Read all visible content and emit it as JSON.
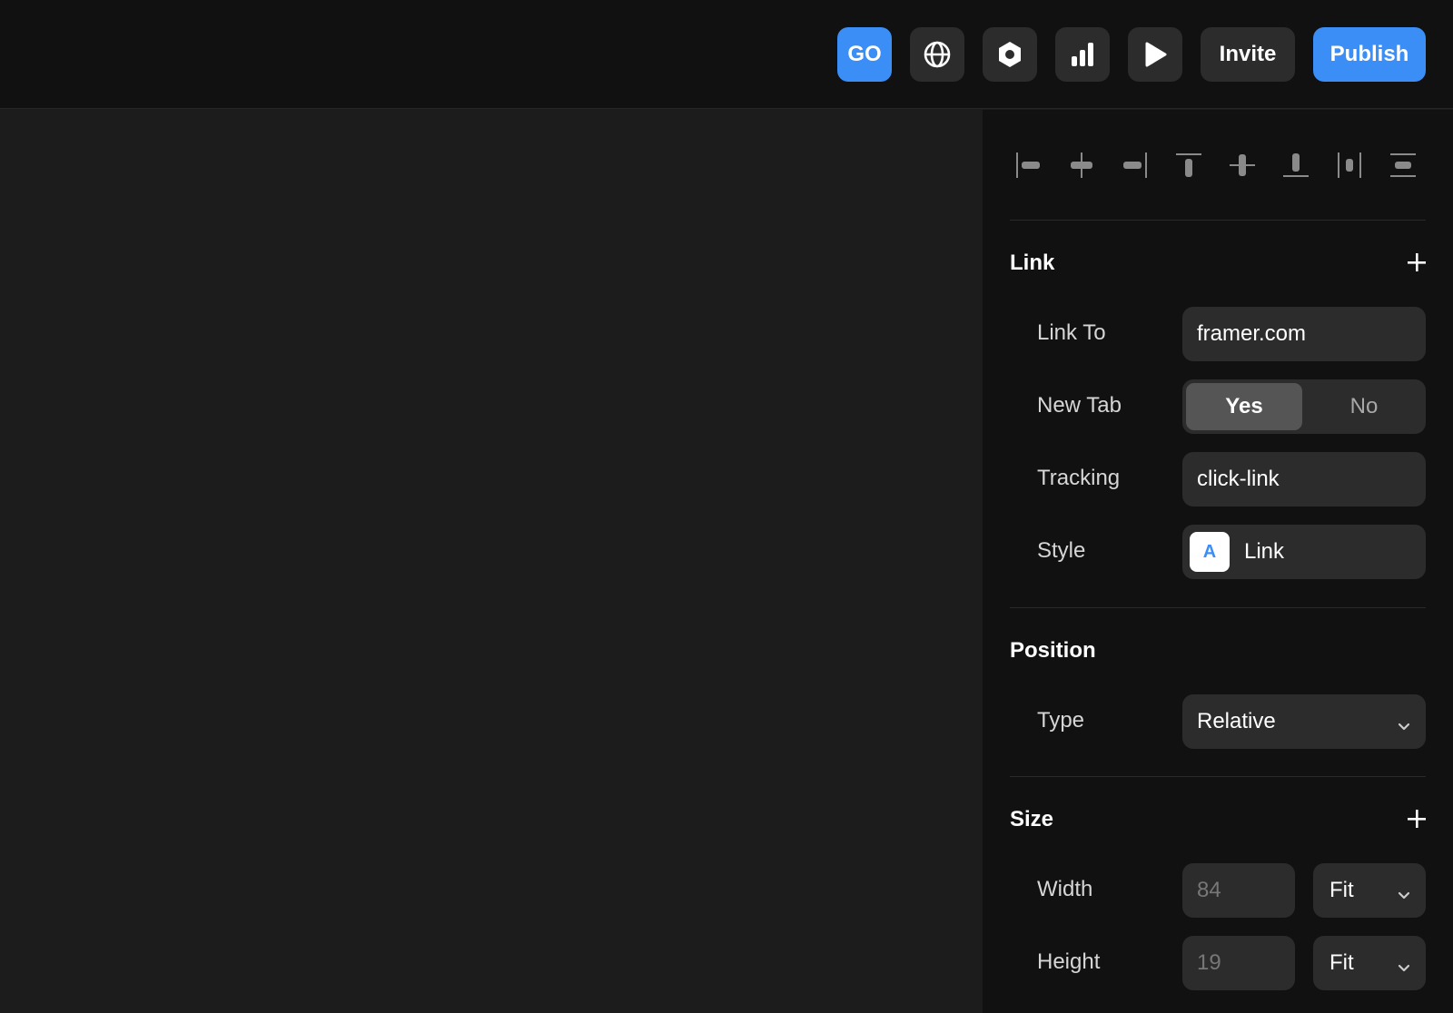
{
  "topbar": {
    "go_label": "GO",
    "invite_label": "Invite",
    "publish_label": "Publish",
    "icons": [
      "globe-icon",
      "hexagon-icon",
      "bar-chart-icon",
      "play-icon"
    ],
    "accent": "#3b8ef5"
  },
  "panel": {
    "align_icons": [
      "align-left-icon",
      "align-center-h-icon",
      "align-right-icon",
      "align-top-icon",
      "align-center-v-icon",
      "align-bottom-icon",
      "distribute-horizontal-icon",
      "distribute-vertical-icon"
    ],
    "link": {
      "title": "Link",
      "link_to_label": "Link To",
      "link_to_value": "framer.com",
      "new_tab_label": "New Tab",
      "new_tab_yes": "Yes",
      "new_tab_no": "No",
      "tracking_label": "Tracking",
      "tracking_value": "click-link",
      "style_label": "Style",
      "style_swatch": "A",
      "style_value": "Link"
    },
    "position": {
      "title": "Position",
      "type_label": "Type",
      "type_value": "Relative"
    },
    "size": {
      "title": "Size",
      "width_label": "Width",
      "width_value": "84",
      "width_mode": "Fit",
      "height_label": "Height",
      "height_value": "19",
      "height_mode": "Fit"
    }
  }
}
